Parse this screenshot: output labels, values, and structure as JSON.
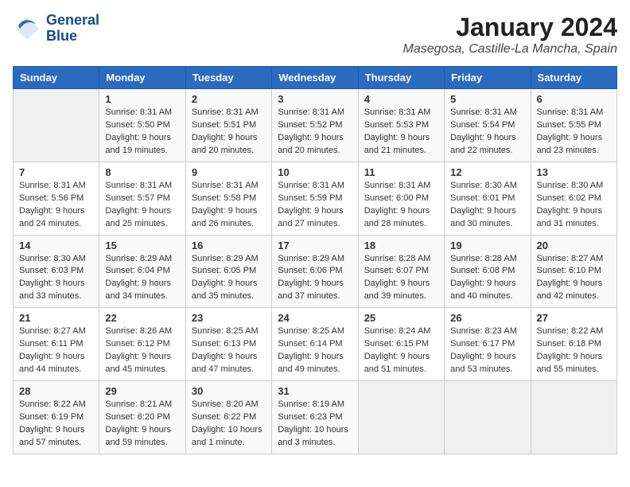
{
  "logo": {
    "line1": "General",
    "line2": "Blue"
  },
  "title": "January 2024",
  "location": "Masegosa, Castille-La Mancha, Spain",
  "weekdays": [
    "Sunday",
    "Monday",
    "Tuesday",
    "Wednesday",
    "Thursday",
    "Friday",
    "Saturday"
  ],
  "weeks": [
    [
      {
        "day": "",
        "info": ""
      },
      {
        "day": "1",
        "info": "Sunrise: 8:31 AM\nSunset: 5:50 PM\nDaylight: 9 hours\nand 19 minutes."
      },
      {
        "day": "2",
        "info": "Sunrise: 8:31 AM\nSunset: 5:51 PM\nDaylight: 9 hours\nand 20 minutes."
      },
      {
        "day": "3",
        "info": "Sunrise: 8:31 AM\nSunset: 5:52 PM\nDaylight: 9 hours\nand 20 minutes."
      },
      {
        "day": "4",
        "info": "Sunrise: 8:31 AM\nSunset: 5:53 PM\nDaylight: 9 hours\nand 21 minutes."
      },
      {
        "day": "5",
        "info": "Sunrise: 8:31 AM\nSunset: 5:54 PM\nDaylight: 9 hours\nand 22 minutes."
      },
      {
        "day": "6",
        "info": "Sunrise: 8:31 AM\nSunset: 5:55 PM\nDaylight: 9 hours\nand 23 minutes."
      }
    ],
    [
      {
        "day": "7",
        "info": "Sunrise: 8:31 AM\nSunset: 5:56 PM\nDaylight: 9 hours\nand 24 minutes."
      },
      {
        "day": "8",
        "info": "Sunrise: 8:31 AM\nSunset: 5:57 PM\nDaylight: 9 hours\nand 25 minutes."
      },
      {
        "day": "9",
        "info": "Sunrise: 8:31 AM\nSunset: 5:58 PM\nDaylight: 9 hours\nand 26 minutes."
      },
      {
        "day": "10",
        "info": "Sunrise: 8:31 AM\nSunset: 5:59 PM\nDaylight: 9 hours\nand 27 minutes."
      },
      {
        "day": "11",
        "info": "Sunrise: 8:31 AM\nSunset: 6:00 PM\nDaylight: 9 hours\nand 28 minutes."
      },
      {
        "day": "12",
        "info": "Sunrise: 8:30 AM\nSunset: 6:01 PM\nDaylight: 9 hours\nand 30 minutes."
      },
      {
        "day": "13",
        "info": "Sunrise: 8:30 AM\nSunset: 6:02 PM\nDaylight: 9 hours\nand 31 minutes."
      }
    ],
    [
      {
        "day": "14",
        "info": "Sunrise: 8:30 AM\nSunset: 6:03 PM\nDaylight: 9 hours\nand 33 minutes."
      },
      {
        "day": "15",
        "info": "Sunrise: 8:29 AM\nSunset: 6:04 PM\nDaylight: 9 hours\nand 34 minutes."
      },
      {
        "day": "16",
        "info": "Sunrise: 8:29 AM\nSunset: 6:05 PM\nDaylight: 9 hours\nand 35 minutes."
      },
      {
        "day": "17",
        "info": "Sunrise: 8:29 AM\nSunset: 6:06 PM\nDaylight: 9 hours\nand 37 minutes."
      },
      {
        "day": "18",
        "info": "Sunrise: 8:28 AM\nSunset: 6:07 PM\nDaylight: 9 hours\nand 39 minutes."
      },
      {
        "day": "19",
        "info": "Sunrise: 8:28 AM\nSunset: 6:08 PM\nDaylight: 9 hours\nand 40 minutes."
      },
      {
        "day": "20",
        "info": "Sunrise: 8:27 AM\nSunset: 6:10 PM\nDaylight: 9 hours\nand 42 minutes."
      }
    ],
    [
      {
        "day": "21",
        "info": "Sunrise: 8:27 AM\nSunset: 6:11 PM\nDaylight: 9 hours\nand 44 minutes."
      },
      {
        "day": "22",
        "info": "Sunrise: 8:26 AM\nSunset: 6:12 PM\nDaylight: 9 hours\nand 45 minutes."
      },
      {
        "day": "23",
        "info": "Sunrise: 8:25 AM\nSunset: 6:13 PM\nDaylight: 9 hours\nand 47 minutes."
      },
      {
        "day": "24",
        "info": "Sunrise: 8:25 AM\nSunset: 6:14 PM\nDaylight: 9 hours\nand 49 minutes."
      },
      {
        "day": "25",
        "info": "Sunrise: 8:24 AM\nSunset: 6:15 PM\nDaylight: 9 hours\nand 51 minutes."
      },
      {
        "day": "26",
        "info": "Sunrise: 8:23 AM\nSunset: 6:17 PM\nDaylight: 9 hours\nand 53 minutes."
      },
      {
        "day": "27",
        "info": "Sunrise: 8:22 AM\nSunset: 6:18 PM\nDaylight: 9 hours\nand 55 minutes."
      }
    ],
    [
      {
        "day": "28",
        "info": "Sunrise: 8:22 AM\nSunset: 6:19 PM\nDaylight: 9 hours\nand 57 minutes."
      },
      {
        "day": "29",
        "info": "Sunrise: 8:21 AM\nSunset: 6:20 PM\nDaylight: 9 hours\nand 59 minutes."
      },
      {
        "day": "30",
        "info": "Sunrise: 8:20 AM\nSunset: 6:22 PM\nDaylight: 10 hours\nand 1 minute."
      },
      {
        "day": "31",
        "info": "Sunrise: 8:19 AM\nSunset: 6:23 PM\nDaylight: 10 hours\nand 3 minutes."
      },
      {
        "day": "",
        "info": ""
      },
      {
        "day": "",
        "info": ""
      },
      {
        "day": "",
        "info": ""
      }
    ]
  ]
}
